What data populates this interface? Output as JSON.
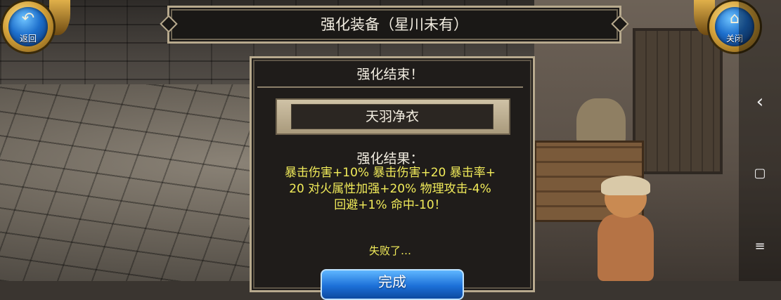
{
  "title_banner": {
    "text": "强化装备（星川未有）"
  },
  "back_button": {
    "label": "返回",
    "icon": "back-arrow-icon"
  },
  "close_button": {
    "label": "关闭",
    "icon": "home-icon"
  },
  "dialog": {
    "header": "强化结束！",
    "item_name": "天羽净衣",
    "result_label": "强化结果：",
    "result_lines": [
      "暴击伤害+10% 暴击伤害+20 暴击率+",
      "20 对火属性加强+20% 物理攻击-4%",
      "回避+1% 命中-10！"
    ],
    "status": "失败了…",
    "done_button": "完成"
  },
  "android_nav": {
    "back": "‹",
    "home": "▢",
    "menu": "≡"
  },
  "colors": {
    "result_text": "#f2ec5a",
    "button_blue": "#1c70d8",
    "frame_border": "#b8aa8e"
  }
}
